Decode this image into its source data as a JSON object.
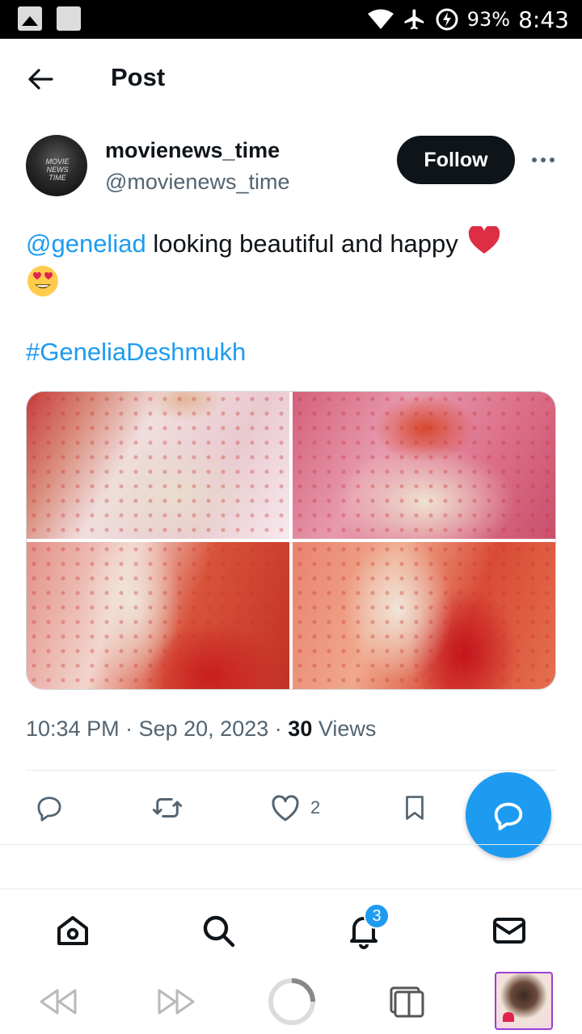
{
  "status_bar": {
    "battery": "93%",
    "time": "8:43"
  },
  "header": {
    "title": "Post"
  },
  "author": {
    "name": "movienews_time",
    "handle": "@movienews_time",
    "avatar_text": "MOVIE NEWS TIME",
    "follow_label": "Follow"
  },
  "tweet": {
    "mention": "@geneliad",
    "text": " looking beautiful and happy",
    "emoji_1": "red-heart",
    "emoji_2": "smiling-face-with-heart-eyes",
    "hashtag": "#GeneliaDeshmukh",
    "media_count": 4
  },
  "meta": {
    "time": "10:34 PM",
    "separator": "·",
    "date": "Sep 20, 2023",
    "views_count": "30",
    "views_label": "Views"
  },
  "actions": {
    "likes": "2"
  },
  "nav": {
    "notifications_badge": "3"
  },
  "colors": {
    "accent": "#1d9bf0",
    "text": "#0f1419",
    "muted": "#536471",
    "heart": "#e0244c"
  }
}
